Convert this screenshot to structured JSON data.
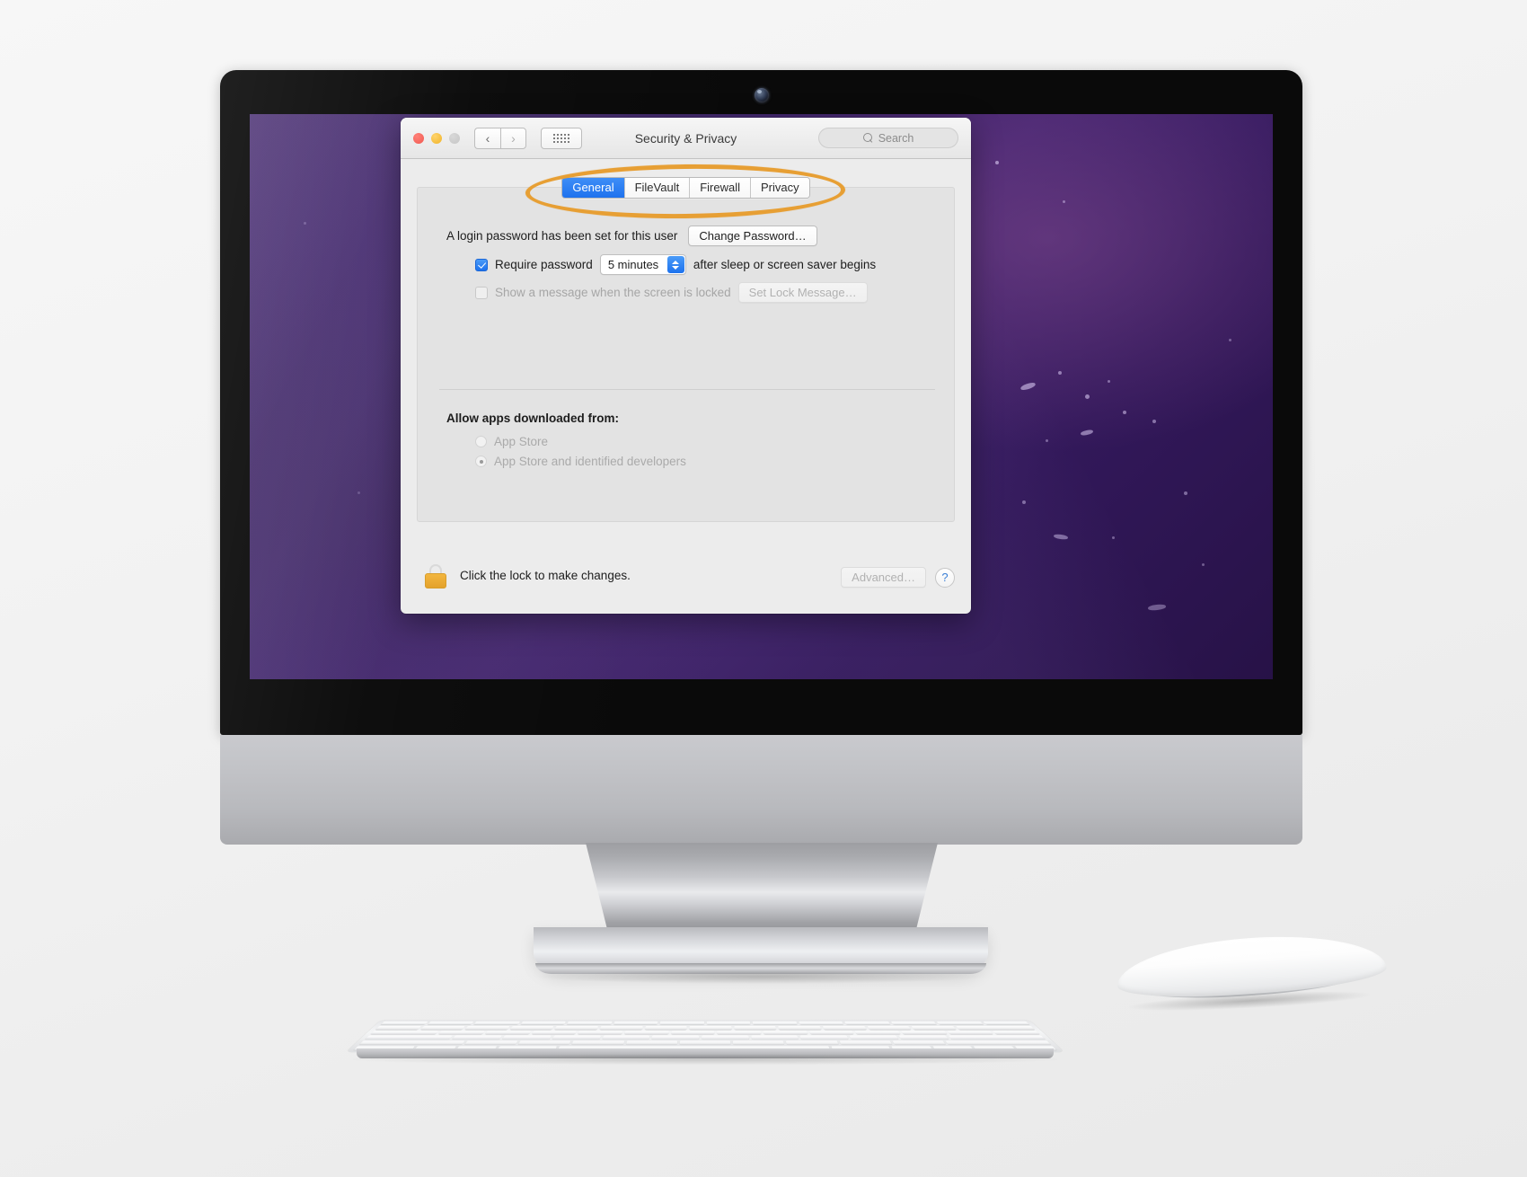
{
  "device": {
    "type": "imac-desktop-computer",
    "camera_label": "facetime-camera",
    "keyboard_label": "apple-wireless-keyboard",
    "mouse_label": "apple-magic-mouse"
  },
  "window": {
    "title": "Security & Privacy",
    "traffic_lights": [
      "close",
      "minimize",
      "zoom"
    ],
    "nav": {
      "back": "‹",
      "forward": "›"
    },
    "show_all_label": "show-all-grid",
    "search": {
      "placeholder": "Search",
      "value": ""
    }
  },
  "tabs": [
    {
      "label": "General",
      "active": true
    },
    {
      "label": "FileVault",
      "active": false
    },
    {
      "label": "Firewall",
      "active": false
    },
    {
      "label": "Privacy",
      "active": false
    }
  ],
  "highlight": {
    "shape": "ellipse",
    "color": "#e79f34",
    "target": "tab-bar"
  },
  "general_pane": {
    "login_password_text": "A login password has been set for this user",
    "change_password_label": "Change Password…",
    "require_password": {
      "checked": true,
      "label": "Require password",
      "delay_value": "5 minutes",
      "suffix": "after sleep or screen saver begins"
    },
    "lock_message": {
      "checked": false,
      "label": "Show a message when the screen is locked",
      "button_label": "Set Lock Message…",
      "disabled": true
    },
    "allow_apps_label": "Allow apps downloaded from:",
    "allow_apps_options": [
      {
        "label": "App Store",
        "selected": false
      },
      {
        "label": "App Store and identified developers",
        "selected": true
      }
    ]
  },
  "footer": {
    "lock_icon": "closed-padlock",
    "lock_text": "Click the lock to make changes.",
    "advanced_label": "Advanced…",
    "advanced_disabled": true,
    "help_label": "?"
  },
  "colors": {
    "accent_blue": "#1d72ee",
    "highlight_orange": "#e79f34",
    "lock_gold": "#e3a22c",
    "window_bg": "#ececec",
    "panel_bg": "#e3e3e3"
  }
}
